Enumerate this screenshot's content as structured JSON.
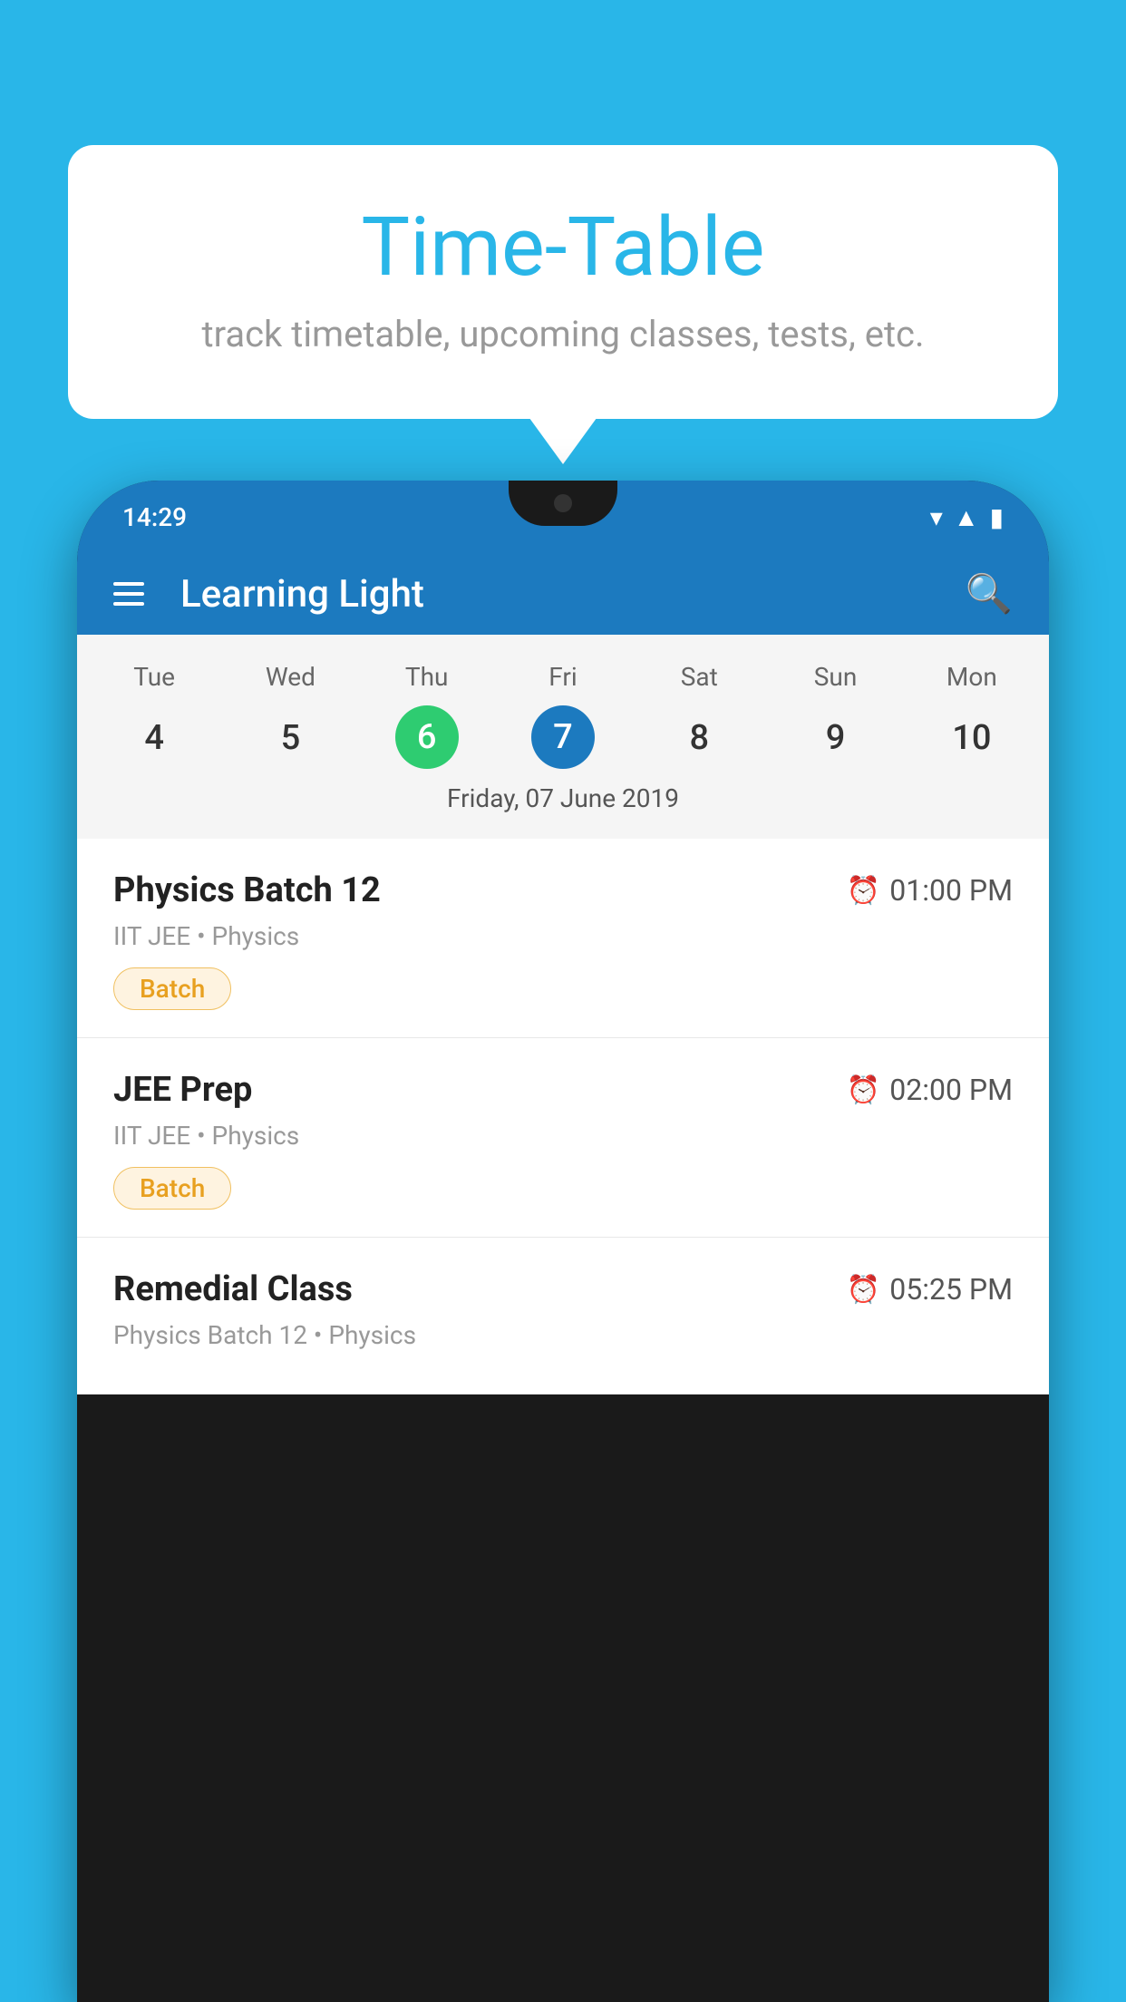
{
  "background_color": "#29b6e8",
  "speech_bubble": {
    "title": "Time-Table",
    "subtitle": "track timetable, upcoming classes, tests, etc."
  },
  "phone": {
    "status_bar": {
      "time": "14:29",
      "icons": [
        "wifi",
        "signal",
        "battery"
      ]
    },
    "app_header": {
      "title": "Learning Light",
      "search_label": "search"
    },
    "calendar": {
      "days": [
        "Tue",
        "Wed",
        "Thu",
        "Fri",
        "Sat",
        "Sun",
        "Mon"
      ],
      "dates": [
        "4",
        "5",
        "6",
        "7",
        "8",
        "9",
        "10"
      ],
      "today_index": 2,
      "selected_index": 3,
      "selected_date_label": "Friday, 07 June 2019"
    },
    "schedule": [
      {
        "title": "Physics Batch 12",
        "time": "01:00 PM",
        "subtitle": "IIT JEE • Physics",
        "badge": "Batch"
      },
      {
        "title": "JEE Prep",
        "time": "02:00 PM",
        "subtitle": "IIT JEE • Physics",
        "badge": "Batch"
      },
      {
        "title": "Remedial Class",
        "time": "05:25 PM",
        "subtitle": "Physics Batch 12 • Physics",
        "badge": ""
      }
    ]
  }
}
